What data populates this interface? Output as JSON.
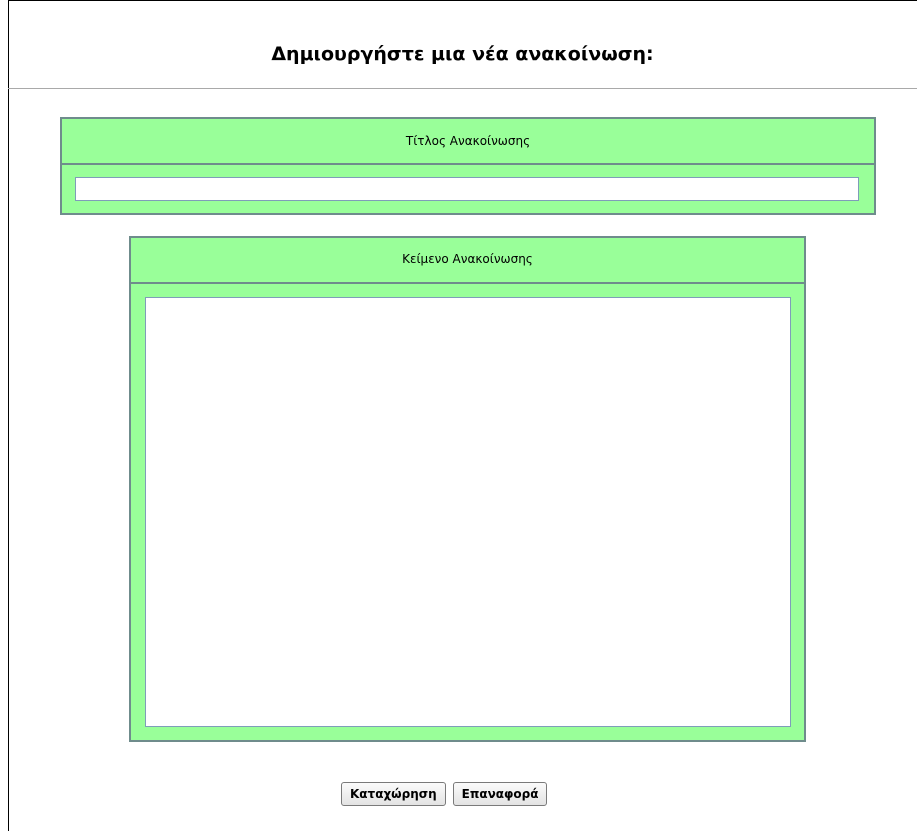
{
  "header": {
    "title": "Δημιουργήστε μια νέα ανακοίνωση:"
  },
  "title_section": {
    "label": "Τίτλος Ανακοίνωσης",
    "value": "",
    "placeholder": ""
  },
  "body_section": {
    "label": "Κείμενο Ανακοίνωσης",
    "value": "",
    "placeholder": ""
  },
  "actions": {
    "submit_label": "Καταχώρηση",
    "reset_label": "Επαναφορά"
  },
  "colors": {
    "panel_background": "#99ff99",
    "panel_border": "#6f8c8c"
  }
}
